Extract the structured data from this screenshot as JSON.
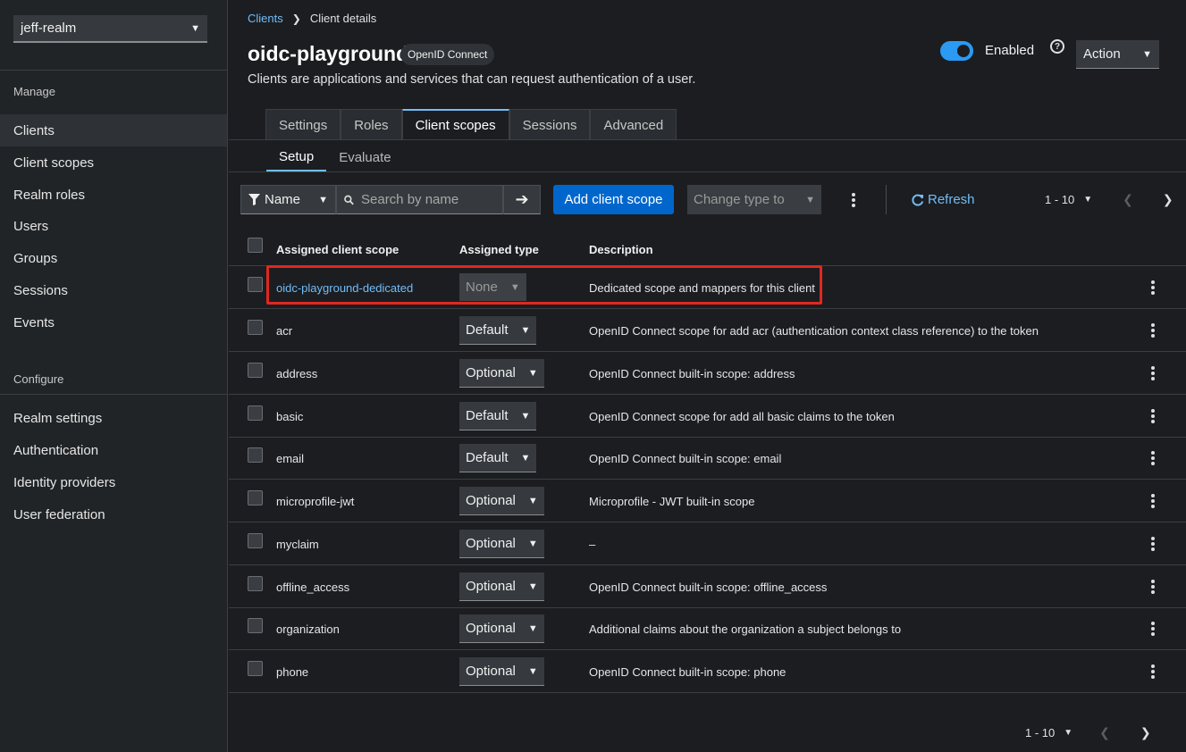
{
  "sidebar": {
    "realm": "jeff-realm",
    "sections": [
      {
        "label": "Manage",
        "items": [
          "Clients",
          "Client scopes",
          "Realm roles",
          "Users",
          "Groups",
          "Sessions",
          "Events"
        ]
      },
      {
        "label": "Configure",
        "items": [
          "Realm settings",
          "Authentication",
          "Identity providers",
          "User federation"
        ]
      }
    ],
    "active_item": "Clients"
  },
  "breadcrumb": {
    "parent": "Clients",
    "current": "Client details"
  },
  "header": {
    "title": "oidc-playground",
    "protocol_badge": "OpenID Connect",
    "subtitle": "Clients are applications and services that can request authentication of a user.",
    "enabled_label": "Enabled",
    "enabled": true,
    "help_icon": "?",
    "action_label": "Action"
  },
  "tabs": [
    "Settings",
    "Roles",
    "Client scopes",
    "Sessions",
    "Advanced"
  ],
  "active_tab": "Client scopes",
  "subtabs": [
    "Setup",
    "Evaluate"
  ],
  "active_subtab": "Setup",
  "toolbar": {
    "filter_label": "Name",
    "search_placeholder": "Search by name",
    "add_label": "Add client scope",
    "change_type_label": "Change type to",
    "refresh_label": "Refresh",
    "pagination": "1 - 10"
  },
  "table": {
    "columns": [
      "Assigned client scope",
      "Assigned type",
      "Description"
    ],
    "rows": [
      {
        "name": "oidc-playground-dedicated",
        "type": "None",
        "description": "Dedicated scope and mappers for this client",
        "link": true
      },
      {
        "name": "acr",
        "type": "Default",
        "description": "OpenID Connect scope for add acr (authentication context class reference) to the token"
      },
      {
        "name": "address",
        "type": "Optional",
        "description": "OpenID Connect built-in scope: address"
      },
      {
        "name": "basic",
        "type": "Default",
        "description": "OpenID Connect scope for add all basic claims to the token"
      },
      {
        "name": "email",
        "type": "Default",
        "description": "OpenID Connect built-in scope: email"
      },
      {
        "name": "microprofile-jwt",
        "type": "Optional",
        "description": "Microprofile - JWT built-in scope"
      },
      {
        "name": "myclaim",
        "type": "Optional",
        "description": "–"
      },
      {
        "name": "offline_access",
        "type": "Optional",
        "description": "OpenID Connect built-in scope: offline_access"
      },
      {
        "name": "organization",
        "type": "Optional",
        "description": "Additional claims about the organization a subject belongs to"
      },
      {
        "name": "phone",
        "type": "Optional",
        "description": "OpenID Connect built-in scope: phone"
      }
    ]
  },
  "footer_pagination": "1 - 10",
  "colors": {
    "accent": "#73bcf7",
    "primary_button": "#0066cc",
    "highlight": "#e0281f",
    "toggle": "#2b9af3"
  }
}
